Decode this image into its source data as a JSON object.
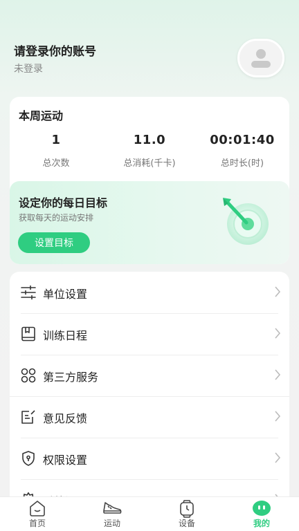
{
  "profile": {
    "title": "请登录你的账号",
    "status": "未登录",
    "avatar_icon": "user-avatar-icon"
  },
  "week": {
    "title": "本周运动",
    "stats": [
      {
        "value": "1",
        "label": "总次数"
      },
      {
        "value": "11.0",
        "label": "总消耗(千卡)"
      },
      {
        "value": "00:01:40",
        "label": "总时长(时)"
      }
    ]
  },
  "goal": {
    "title": "设定你的每日目标",
    "subtitle": "获取每天的运动安排",
    "button": "设置目标",
    "art_icon": "target-dart-icon"
  },
  "menu": {
    "items": [
      {
        "label": "单位设置",
        "icon": "sliders-icon"
      },
      {
        "label": "训练日程",
        "icon": "calendar-book-icon"
      },
      {
        "label": "第三方服务",
        "icon": "grid-apps-icon"
      },
      {
        "label": "意见反馈",
        "icon": "feedback-edit-icon"
      },
      {
        "label": "权限设置",
        "icon": "shield-lock-icon"
      },
      {
        "label": "系统设置",
        "icon": "gear-icon"
      }
    ]
  },
  "tabs": [
    {
      "label": "首页",
      "icon": "home-icon"
    },
    {
      "label": "运动",
      "icon": "sneaker-icon"
    },
    {
      "label": "设备",
      "icon": "watch-icon"
    },
    {
      "label": "我的",
      "icon": "profile-face-icon",
      "active": true
    }
  ],
  "colors": {
    "accent": "#2fcd81",
    "text": "#222222",
    "muted": "#777777"
  }
}
